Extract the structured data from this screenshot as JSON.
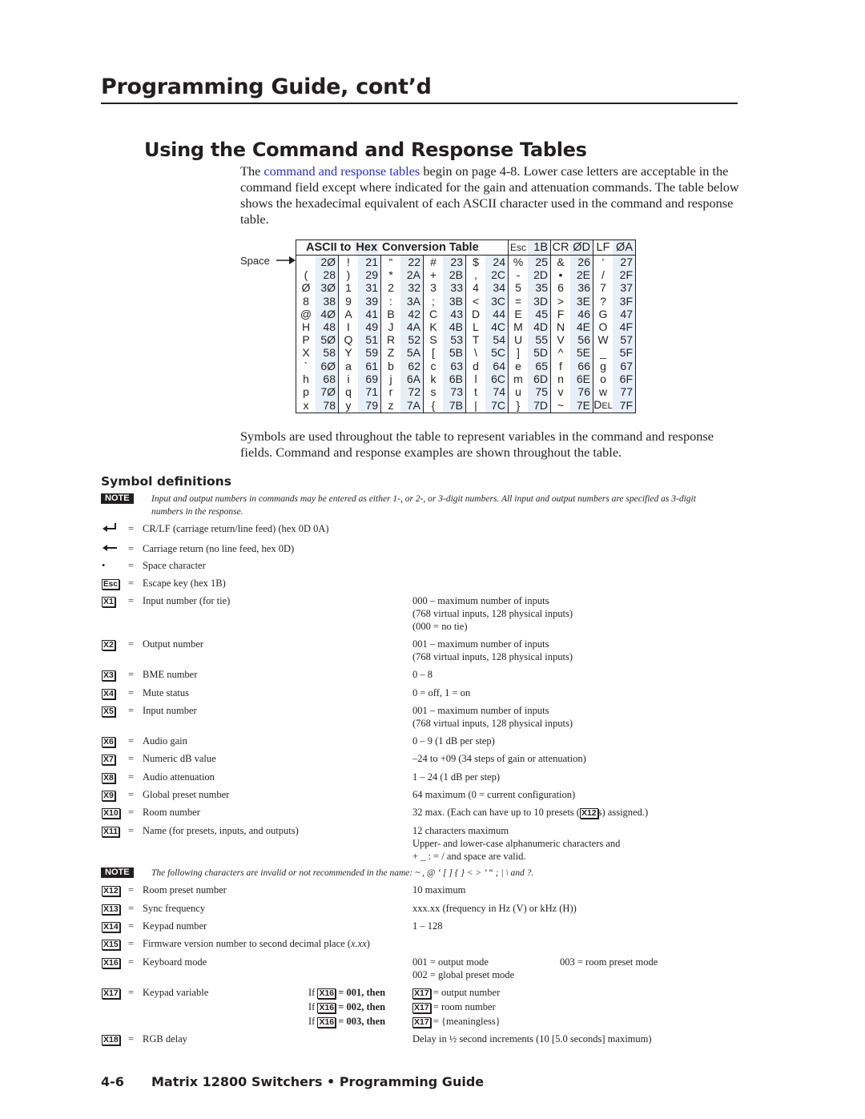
{
  "header": {
    "page_title": "Programming Guide, cont’d",
    "section_title": "Using the Command and Response Tables"
  },
  "intro": {
    "prefix": "The ",
    "link": "command and response tables",
    "rest": " begin on page 4-8.  Lower case letters are acceptable in the command field except where indicated for the gain and attenuation commands.  The table below shows the hexadecimal equivalent of each ASCII character used in the command and response table."
  },
  "ascii_table": {
    "title_a": "ASCII to ",
    "title_hex": "Hex",
    "title_b": "  Conversion Table",
    "space_label": "Space",
    "header_pairs": [
      [
        "Esc",
        "1B"
      ],
      [
        "CR",
        "ØD"
      ],
      [
        "LF",
        "ØA"
      ]
    ],
    "rows": [
      [
        [
          " ",
          "2Ø"
        ],
        [
          "!",
          "21"
        ],
        [
          "“",
          "22"
        ],
        [
          "#",
          "23"
        ],
        [
          "$",
          "24"
        ],
        [
          "%",
          "25"
        ],
        [
          "&",
          "26"
        ],
        [
          "‘",
          "27"
        ]
      ],
      [
        [
          "(",
          "28"
        ],
        [
          ")",
          "29"
        ],
        [
          "*",
          "2A"
        ],
        [
          "+",
          "2B"
        ],
        [
          ",",
          "2C"
        ],
        [
          "-",
          "2D"
        ],
        [
          "•",
          "2E"
        ],
        [
          "/",
          "2F"
        ]
      ],
      [
        [
          "Ø",
          "3Ø"
        ],
        [
          "1",
          "31"
        ],
        [
          "2",
          "32"
        ],
        [
          "3",
          "33"
        ],
        [
          "4",
          "34"
        ],
        [
          "5",
          "35"
        ],
        [
          "6",
          "36"
        ],
        [
          "7",
          "37"
        ]
      ],
      [
        [
          "8",
          "38"
        ],
        [
          "9",
          "39"
        ],
        [
          ":",
          "3A"
        ],
        [
          ";",
          "3B"
        ],
        [
          "<",
          "3C"
        ],
        [
          "=",
          "3D"
        ],
        [
          ">",
          "3E"
        ],
        [
          "?",
          "3F"
        ]
      ],
      [
        [
          "@",
          "4Ø"
        ],
        [
          "A",
          "41"
        ],
        [
          "B",
          "42"
        ],
        [
          "C",
          "43"
        ],
        [
          "D",
          "44"
        ],
        [
          "E",
          "45"
        ],
        [
          "F",
          "46"
        ],
        [
          "G",
          "47"
        ]
      ],
      [
        [
          "H",
          "48"
        ],
        [
          "I",
          "49"
        ],
        [
          "J",
          "4A"
        ],
        [
          "K",
          "4B"
        ],
        [
          "L",
          "4C"
        ],
        [
          "M",
          "4D"
        ],
        [
          "N",
          "4E"
        ],
        [
          "O",
          "4F"
        ]
      ],
      [
        [
          "P",
          "5Ø"
        ],
        [
          "Q",
          "51"
        ],
        [
          "R",
          "52"
        ],
        [
          "S",
          "53"
        ],
        [
          "T",
          "54"
        ],
        [
          "U",
          "55"
        ],
        [
          "V",
          "56"
        ],
        [
          "W",
          "57"
        ]
      ],
      [
        [
          "X",
          "58"
        ],
        [
          "Y",
          "59"
        ],
        [
          "Z",
          "5A"
        ],
        [
          "[",
          "5B"
        ],
        [
          "\\",
          "5C"
        ],
        [
          "]",
          "5D"
        ],
        [
          "^",
          "5E"
        ],
        [
          "_",
          "5F"
        ]
      ],
      [
        [
          "`",
          "6Ø"
        ],
        [
          "a",
          "61"
        ],
        [
          "b",
          "62"
        ],
        [
          "c",
          "63"
        ],
        [
          "d",
          "64"
        ],
        [
          "e",
          "65"
        ],
        [
          "f",
          "66"
        ],
        [
          "g",
          "67"
        ]
      ],
      [
        [
          "h",
          "68"
        ],
        [
          "i",
          "69"
        ],
        [
          "j",
          "6A"
        ],
        [
          "k",
          "6B"
        ],
        [
          "l",
          "6C"
        ],
        [
          "m",
          "6D"
        ],
        [
          "n",
          "6E"
        ],
        [
          "o",
          "6F"
        ]
      ],
      [
        [
          "p",
          "7Ø"
        ],
        [
          "q",
          "71"
        ],
        [
          "r",
          "72"
        ],
        [
          "s",
          "73"
        ],
        [
          "t",
          "74"
        ],
        [
          "u",
          "75"
        ],
        [
          "v",
          "76"
        ],
        [
          "w",
          "77"
        ]
      ],
      [
        [
          "x",
          "78"
        ],
        [
          "y",
          "79"
        ],
        [
          "z",
          "7A"
        ],
        [
          "{",
          "7B"
        ],
        [
          "|",
          "7C"
        ],
        [
          "}",
          "7D"
        ],
        [
          "~",
          "7E"
        ],
        [
          "DEL",
          "7F"
        ]
      ]
    ]
  },
  "symbols_para": "Symbols are used throughout the table to represent variables in the command and response fields.  Command and response examples are shown throughout the table.",
  "symbol_definitions": {
    "heading": "Symbol definitions",
    "note_label": "NOTE",
    "note1": "Input and output numbers in commands may be entered as either 1-, or 2-, or 3-digit numbers.  All input and output numbers are specified as 3-digit numbers in the response.",
    "note2": "The following characters are invalid or not recommended in the name: ~ , @ ‘ [ ] { } < > ’ “ ; | \\ and ?.",
    "equals": "=",
    "basic": [
      {
        "icon": "crlf-arrow-icon",
        "glyph": "↵",
        "def": "CR/LF (carriage return/line feed) (hex 0D 0A)"
      },
      {
        "icon": "carriage-return-arrow-icon",
        "glyph": "←",
        "def": "Carriage return (no line feed, hex 0D)"
      },
      {
        "icon": "space-dot-icon",
        "glyph": "•",
        "def": "Space character"
      },
      {
        "icon": "esc-key-icon",
        "glyph": "Esc",
        "def": "Escape key (hex 1B)"
      }
    ],
    "vars": [
      {
        "sym": "X1",
        "def": "Input number (for tie)",
        "val": [
          "000 – maximum number of inputs",
          "(768 virtual inputs, 128 physical inputs)",
          "(000 = no tie)"
        ]
      },
      {
        "sym": "X2",
        "def": "Output number",
        "val": [
          "001 – maximum number of inputs",
          "(768 virtual inputs, 128 physical inputs)"
        ]
      },
      {
        "sym": "X3",
        "def": "BME number",
        "val": [
          "0 – 8"
        ]
      },
      {
        "sym": "X4",
        "def": "Mute status",
        "val": [
          "0 = off, 1 = on"
        ]
      },
      {
        "sym": "X5",
        "def": "Input number",
        "val": [
          "001 – maximum number of inputs",
          "(768 virtual inputs, 128 physical inputs)"
        ]
      },
      {
        "sym": "X6",
        "def": "Audio gain",
        "val": [
          "0 – 9 (1 dB per step)"
        ]
      },
      {
        "sym": "X7",
        "def": "Numeric dB value",
        "val": [
          "–24 to +09 (34 steps of gain or attenuation)"
        ]
      },
      {
        "sym": "X8",
        "def": "Audio attenuation",
        "val": [
          "1 – 24 (1 dB per step)"
        ]
      },
      {
        "sym": "X9",
        "def": "Global preset number",
        "val": [
          "64 maximum (0 = current configuration)"
        ]
      },
      {
        "sym": "X10",
        "def": "Room number",
        "val_a": "32 max. (Each can have up to 10 presets (",
        "val_sym": "X12",
        "val_b": "s) assigned.)"
      },
      {
        "sym": "X11",
        "def": "Name (for presets, inputs, and outputs)",
        "val": [
          "12 characters maximum",
          "Upper- and lower-case alphanumeric characters and",
          "+  _  :  =  /  and space are valid."
        ]
      },
      {
        "sym": "X12",
        "def": "Room preset number",
        "val": [
          "10 maximum"
        ]
      },
      {
        "sym": "X13",
        "def": "Sync frequency",
        "val": [
          "xxx.xx (frequency in Hz (V) or kHz (H))"
        ]
      },
      {
        "sym": "X14",
        "def": "Keypad number",
        "val": [
          "1 – 128"
        ]
      },
      {
        "sym": "X15",
        "def": "Firmware version number to second decimal place (",
        "def_italic": "x.xx",
        "def_end": ")"
      },
      {
        "sym": "X16",
        "def": "Keyboard mode",
        "val": [
          "001 = output mode",
          "002 = global preset mode"
        ],
        "val_right": "003 = room preset mode"
      },
      {
        "sym": "X17",
        "def": "Keypad variable",
        "conditions": [
          {
            "if": "If ",
            "sym": "X16",
            "eq": " = 001, then",
            "res_sym": "X17",
            "res": " = output number"
          },
          {
            "if": "If ",
            "sym": "X16",
            "eq": " = 002, then",
            "res_sym": "X17",
            "res": " = room number"
          },
          {
            "if": "If ",
            "sym": "X16",
            "eq": " = 003, then",
            "res_sym": "X17",
            "res": " = {meaningless}"
          }
        ]
      },
      {
        "sym": "X18",
        "def": "RGB delay",
        "val": [
          "Delay in ½ second increments (10 [5.0 seconds] maximum)"
        ]
      }
    ]
  },
  "footer": {
    "page_number": "4-6",
    "title": "Matrix 12800 Switchers • Programming Guide"
  }
}
